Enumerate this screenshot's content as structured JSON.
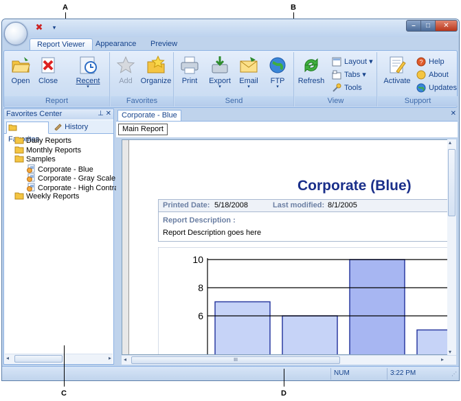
{
  "callouts": {
    "a": "A",
    "b": "B",
    "c": "C",
    "d": "D"
  },
  "tabs": [
    {
      "label": "Report Viewer",
      "active": true
    },
    {
      "label": "Appearance",
      "active": false
    },
    {
      "label": "Preview",
      "active": false
    }
  ],
  "ribbon": {
    "groups": {
      "report": "Report",
      "favorites": "Favorites",
      "send": "Send",
      "view": "View",
      "support": "Support"
    },
    "buttons": {
      "open": "Open",
      "close": "Close",
      "recent": "Recent",
      "add": "Add",
      "organize": "Organize",
      "print": "Print",
      "export": "Export",
      "email": "Email",
      "ftp": "FTP",
      "refresh": "Refresh",
      "layout": "Layout",
      "tabs": "Tabs",
      "tools": "Tools",
      "activate": "Activate",
      "help": "Help",
      "about": "About",
      "updates": "Updates"
    }
  },
  "favorites_panel": {
    "title": "Favorites Center",
    "tabs": [
      {
        "label": "Favorites",
        "active": true
      },
      {
        "label": "History",
        "active": false
      }
    ],
    "tree": [
      {
        "label": "Daily Reports",
        "type": "folder",
        "level": 0
      },
      {
        "label": "Monthly Reports",
        "type": "folder",
        "level": 0
      },
      {
        "label": "Samples",
        "type": "folder",
        "level": 0
      },
      {
        "label": "Corporate - Blue",
        "type": "report",
        "level": 1
      },
      {
        "label": "Corporate - Gray Scale",
        "type": "report",
        "level": 1
      },
      {
        "label": "Corporate - High Contrast",
        "type": "report",
        "level": 1
      },
      {
        "label": "Weekly Reports",
        "type": "folder",
        "level": 0
      }
    ]
  },
  "document": {
    "tab": "Corporate - Blue",
    "subtab": "Main Report",
    "report_title": "Corporate (Blue)",
    "printed_date_label": "Printed Date:",
    "printed_date": "5/18/2008",
    "last_modified_label": "Last modified:",
    "last_modified": "8/1/2005",
    "description_label": "Report Description :",
    "description": "Report Description goes here",
    "hscroll_label": "III"
  },
  "chart_data": {
    "type": "bar",
    "yticks": [
      6,
      8,
      10
    ],
    "values": [
      7,
      6,
      10,
      5
    ],
    "ylim": [
      5,
      10
    ],
    "grid": true
  },
  "status": {
    "num": "NUM",
    "time": "3:22 PM"
  },
  "colors": {
    "title_blue": "#1a2f8a",
    "bar_fill": "#c6d3f7",
    "bar_stroke": "#2a3aa0"
  }
}
